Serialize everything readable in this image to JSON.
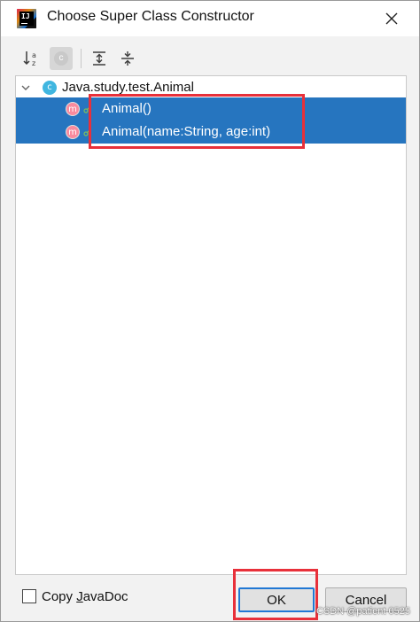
{
  "window": {
    "title": "Choose Super Class Constructor"
  },
  "tree": {
    "root": {
      "icon_letter": "c",
      "label": "Java.study.test.Animal",
      "expanded": true
    },
    "items": [
      {
        "icon_letter": "m",
        "label": "Animal()",
        "selected": true
      },
      {
        "icon_letter": "m",
        "label": "Animal(name:String, age:int)",
        "selected": true
      }
    ]
  },
  "toolbar": {
    "sort_icon": "sort-alpha-icon",
    "class_icon_letter": "c",
    "expand_icon": "expand-all-icon",
    "collapse_icon": "collapse-all-icon"
  },
  "copy_javadoc": {
    "label_prefix": "Copy ",
    "label_mnemonic": "J",
    "label_suffix": "avaDoc",
    "checked": false
  },
  "buttons": {
    "ok_label": "OK",
    "cancel_label": "Cancel"
  },
  "watermark": "CSDN @patient 0525",
  "colors": {
    "selection": "#2675bf",
    "annotation_red": "#e8303a",
    "class_icon": "#40b6e0",
    "method_icon": "#f98b9e",
    "ok_border": "#2178d4"
  }
}
